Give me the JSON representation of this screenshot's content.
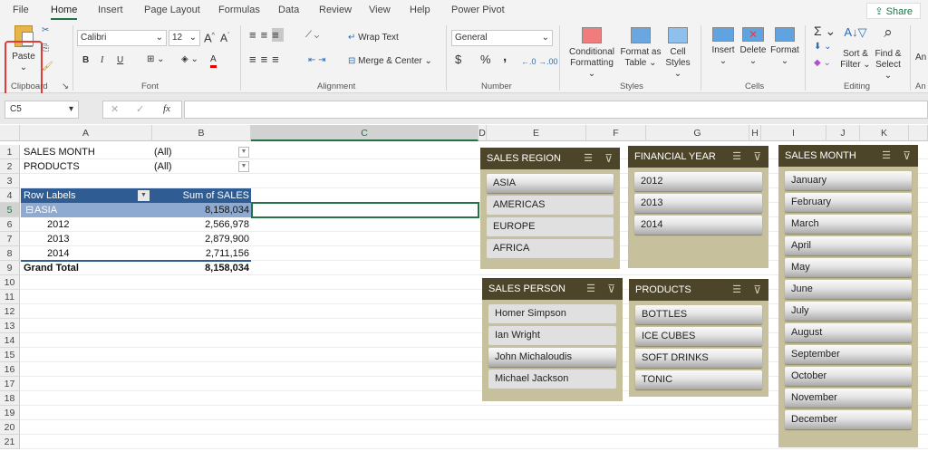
{
  "ribbon": {
    "tabs": [
      "File",
      "Home",
      "Insert",
      "Page Layout",
      "Formulas",
      "Data",
      "Review",
      "View",
      "Help",
      "Power Pivot"
    ],
    "share": "Share",
    "clipboard": {
      "paste": "Paste",
      "group": "Clipboard"
    },
    "font": {
      "name": "Calibri",
      "size": "12",
      "bold": "B",
      "italic": "I",
      "underline": "U",
      "group": "Font"
    },
    "alignment": {
      "wrap": "Wrap Text",
      "merge": "Merge & Center",
      "group": "Alignment"
    },
    "number": {
      "format": "General",
      "currency": "$",
      "percent": "%",
      "comma": ",",
      "group": "Number"
    },
    "styles": {
      "conditional": [
        "Conditional",
        "Formatting"
      ],
      "format_table": [
        "Format as",
        "Table"
      ],
      "cell_styles": [
        "Cell",
        "Styles"
      ],
      "group": "Styles"
    },
    "cells": {
      "insert": "Insert",
      "delete": "Delete",
      "format": "Format",
      "group": "Cells"
    },
    "editing": {
      "sort": [
        "Sort &",
        "Filter"
      ],
      "find": [
        "Find &",
        "Select"
      ],
      "group": "Editing"
    },
    "analyze": {
      "label": "An",
      "group": "An"
    }
  },
  "formula_bar": {
    "name_box": "C5",
    "fx": "fx",
    "value": ""
  },
  "columns": [
    "A",
    "B",
    "C",
    "D",
    "E",
    "F",
    "G",
    "H",
    "I",
    "J",
    "K"
  ],
  "rows": [
    "1",
    "2",
    "3",
    "4",
    "5",
    "6",
    "7",
    "8",
    "9",
    "10",
    "11",
    "12",
    "13",
    "14",
    "15",
    "16",
    "17",
    "18",
    "19",
    "20",
    "21"
  ],
  "pivot": {
    "filters": [
      {
        "label": "SALES MONTH",
        "value": "(All)"
      },
      {
        "label": "PRODUCTS",
        "value": "(All)"
      }
    ],
    "header": {
      "rows": "Row Labels",
      "values": "Sum of SALES"
    },
    "group": {
      "label": "ASIA",
      "value": "8,158,034"
    },
    "items": [
      {
        "label": "2012",
        "value": "2,566,978"
      },
      {
        "label": "2013",
        "value": "2,879,900"
      },
      {
        "label": "2014",
        "value": "2,711,156"
      }
    ],
    "total": {
      "label": "Grand Total",
      "value": "8,158,034"
    }
  },
  "slicers": [
    {
      "title": "SALES REGION",
      "items": [
        {
          "label": "ASIA",
          "on": true
        },
        {
          "label": "AMERICAS",
          "on": false
        },
        {
          "label": "EUROPE",
          "on": false
        },
        {
          "label": "AFRICA",
          "on": false
        }
      ]
    },
    {
      "title": "FINANCIAL YEAR",
      "items": [
        {
          "label": "2012",
          "on": true
        },
        {
          "label": "2013",
          "on": true
        },
        {
          "label": "2014",
          "on": true
        }
      ]
    },
    {
      "title": "SALES MONTH",
      "items": [
        {
          "label": "January",
          "on": true
        },
        {
          "label": "February",
          "on": true
        },
        {
          "label": "March",
          "on": true
        },
        {
          "label": "April",
          "on": true
        },
        {
          "label": "May",
          "on": true
        },
        {
          "label": "June",
          "on": true
        },
        {
          "label": "July",
          "on": true
        },
        {
          "label": "August",
          "on": true
        },
        {
          "label": "September",
          "on": true
        },
        {
          "label": "October",
          "on": true
        },
        {
          "label": "November",
          "on": true
        },
        {
          "label": "December",
          "on": true
        }
      ]
    },
    {
      "title": "SALES PERSON",
      "items": [
        {
          "label": "Homer Simpson",
          "on": false
        },
        {
          "label": "Ian Wright",
          "on": false
        },
        {
          "label": "John Michaloudis",
          "on": true
        },
        {
          "label": "Michael Jackson",
          "on": false
        }
      ]
    },
    {
      "title": "PRODUCTS",
      "items": [
        {
          "label": "BOTTLES",
          "on": true
        },
        {
          "label": "ICE CUBES",
          "on": true
        },
        {
          "label": "SOFT DRINKS",
          "on": true
        },
        {
          "label": "TONIC",
          "on": true
        }
      ]
    }
  ],
  "colors": {
    "accent": "#217346",
    "slicer_header": "#4d4529",
    "slicer_body": "#c7c09c",
    "pivot_header": "#2f5c92",
    "pivot_group": "#8eaad0",
    "paste_highlight": "#e23b3b"
  }
}
